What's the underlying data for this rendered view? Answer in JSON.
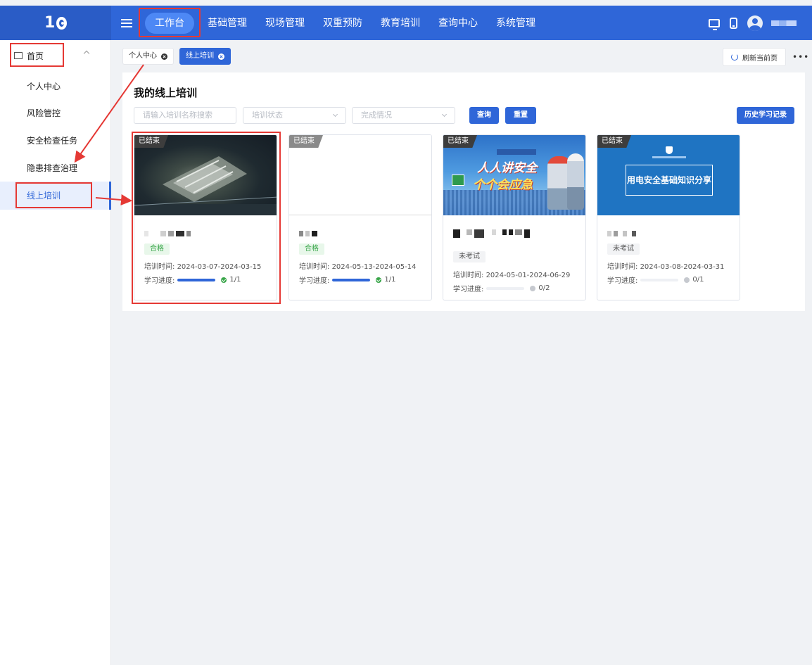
{
  "nav": {
    "items": [
      "工作台",
      "基础管理",
      "现场管理",
      "双重预防",
      "教育培训",
      "查询中心",
      "系统管理"
    ],
    "active_index": 0
  },
  "sidebar": {
    "home": "首页",
    "items": [
      "个人中心",
      "风险管控",
      "安全检查任务",
      "隐患排查治理",
      "线上培训"
    ],
    "active_index": 4
  },
  "tabs": [
    {
      "label": "个人中心",
      "active": false
    },
    {
      "label": "线上培训",
      "active": true
    }
  ],
  "toolbar": {
    "refresh_label": "刷新当前页",
    "more_label": "•••"
  },
  "page": {
    "title": "我的线上培训",
    "search_placeholder": "请输入培训名称搜索",
    "status_placeholder": "培训状态",
    "completion_placeholder": "完成情况",
    "query_label": "查询",
    "reset_label": "重置",
    "history_label": "历史学习记录"
  },
  "cards": [
    {
      "badge": "已结束",
      "status": "合格",
      "status_type": "pass",
      "time_label": "培训时间:",
      "time": "2024-03-07-2024-03-15",
      "progress_label": "学习进度:",
      "progress_text": "1/1",
      "progress": 1.0
    },
    {
      "badge": "已结束",
      "status": "合格",
      "status_type": "pass",
      "time_label": "培训时间:",
      "time": "2024-05-13-2024-05-14",
      "progress_label": "学习进度:",
      "progress_text": "1/1",
      "progress": 1.0
    },
    {
      "badge": "已结束",
      "status": "未考试",
      "status_type": "none",
      "time_label": "培训时间:",
      "time": "2024-05-01-2024-06-29",
      "progress_label": "学习进度:",
      "progress_text": "0/2",
      "progress": 0.0,
      "thumb_text_1": "人人讲安全",
      "thumb_text_2": "个个会应急"
    },
    {
      "badge": "已结束",
      "status": "未考试",
      "status_type": "none",
      "time_label": "培训时间:",
      "time": "2024-03-08-2024-03-31",
      "progress_label": "学习进度:",
      "progress_text": "0/1",
      "progress": 0.0,
      "thumb_text_1": "用电安全基础知识分享"
    }
  ],
  "colors": {
    "primary": "#2f66d8",
    "annotation": "#e53935",
    "pass": "#3aa64a"
  }
}
